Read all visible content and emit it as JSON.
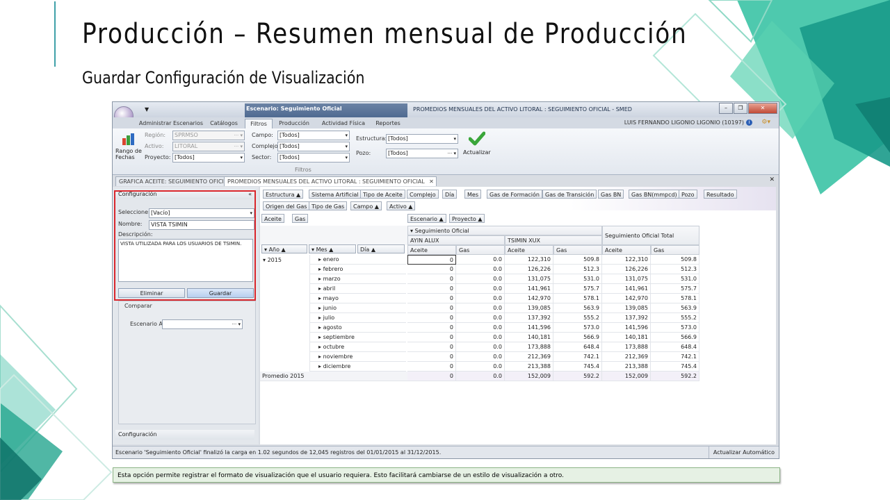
{
  "slide": {
    "title": "Producción – Resumen mensual de Producción",
    "subtitle": "Guardar Configuración de Visualización",
    "caption": "Esta opción permite registrar el formato de visualización que el usuario requiera. Esto facilitará cambiarse de un estilo de visualización a otro."
  },
  "app": {
    "context_tab": "Escenario: Seguimiento Oficial",
    "window_title": "PROMEDIOS MENSUALES  DEL ACTIVO LITORAL : SEGUIMIENTO OFICIAL - SMED",
    "user": "LUIS FERNANDO LIGONIO LIGONIO (10197)",
    "ribbon_tabs": [
      "Administrar Escenarios",
      "Catálogos",
      "Filtros",
      "Producción",
      "Actividad Física",
      "Reportes"
    ],
    "rango_label": "Rango de Fechas",
    "filters": {
      "region_label": "Región:",
      "region_value": "SPRMSO",
      "activo_label": "Activo:",
      "activo_value": "LITORAL",
      "proyecto_label": "Proyecto:",
      "proyecto_value": "[Todos]",
      "campo_label": "Campo:",
      "campo_value": "[Todos]",
      "complejo_label": "Complejo:",
      "complejo_value": "[Todos]",
      "sector_label": "Sector:",
      "sector_value": "[Todos]",
      "estructura_label": "Estructura:",
      "estructura_value": "[Todos]",
      "pozo_label": "Pozo:",
      "pozo_value": "[Todos]",
      "group_label": "Filtros",
      "actualizar_label": "Actualizar"
    },
    "doc_tabs": [
      "GRAFICA ACEITE: SEGUIMIENTO OFICIAL",
      "PROMEDIOS MENSUALES  DEL ACTIVO LITORAL : SEGUIMIENTO OFICIAL"
    ],
    "config": {
      "header": "Configuración",
      "seleccione_label": "Seleccione:",
      "seleccione_value": "[Vacío]",
      "nombre_label": "Nombre:",
      "nombre_value": "VISTA TSIMIN",
      "descripcion_label": "Descripción:",
      "descripcion_value": "VISTA UTILIZADA PARA LOS USUARIOS DE TSIMIN.",
      "eliminar": "Eliminar",
      "guardar": "Guardar",
      "comparar": "Comparar",
      "escenario_a_label": "Escenario A:",
      "footer": "Configuración"
    },
    "field_buttons_row1": [
      "Estructura ▲",
      "Sistema Artificial",
      "Tipo de Aceite",
      "Complejo",
      "Día",
      "Mes",
      "Gas de Formación",
      "Gas de Transición",
      "Gas BN",
      "Gas BN(mmpcd)",
      "Pozo",
      "Resultado"
    ],
    "field_buttons_row2": [
      "Origen del Gas",
      "Tipo de Gas",
      "Campo ▲",
      "Activo ▲"
    ],
    "data_fields": [
      "Aceite",
      "Gas"
    ],
    "column_fields": [
      "Escenario ▲",
      "Proyecto ▲"
    ],
    "row_fields": [
      "Año",
      "Mes",
      "Día"
    ],
    "col_headers": {
      "scenario": "Seguimiento Oficial",
      "proj1": "AYIN ALUX",
      "proj2": "TSIMIN XUX",
      "total": "Seguimiento Oficial Total",
      "aceite": "Aceite",
      "gas": "Gas"
    },
    "year": "2015",
    "rows": [
      {
        "mes": "enero",
        "v": [
          "0",
          "0.0",
          "122,310",
          "509.8",
          "122,310",
          "509.8"
        ]
      },
      {
        "mes": "febrero",
        "v": [
          "0",
          "0.0",
          "126,226",
          "512.3",
          "126,226",
          "512.3"
        ]
      },
      {
        "mes": "marzo",
        "v": [
          "0",
          "0.0",
          "131,075",
          "531.0",
          "131,075",
          "531.0"
        ]
      },
      {
        "mes": "abril",
        "v": [
          "0",
          "0.0",
          "141,961",
          "575.7",
          "141,961",
          "575.7"
        ]
      },
      {
        "mes": "mayo",
        "v": [
          "0",
          "0.0",
          "142,970",
          "578.1",
          "142,970",
          "578.1"
        ]
      },
      {
        "mes": "junio",
        "v": [
          "0",
          "0.0",
          "139,085",
          "563.9",
          "139,085",
          "563.9"
        ]
      },
      {
        "mes": "julio",
        "v": [
          "0",
          "0.0",
          "137,392",
          "555.2",
          "137,392",
          "555.2"
        ]
      },
      {
        "mes": "agosto",
        "v": [
          "0",
          "0.0",
          "141,596",
          "573.0",
          "141,596",
          "573.0"
        ]
      },
      {
        "mes": "septiembre",
        "v": [
          "0",
          "0.0",
          "140,181",
          "566.9",
          "140,181",
          "566.9"
        ]
      },
      {
        "mes": "octubre",
        "v": [
          "0",
          "0.0",
          "173,888",
          "648.4",
          "173,888",
          "648.4"
        ]
      },
      {
        "mes": "noviembre",
        "v": [
          "0",
          "0.0",
          "212,369",
          "742.1",
          "212,369",
          "742.1"
        ]
      },
      {
        "mes": "diciembre",
        "v": [
          "0",
          "0.0",
          "213,388",
          "745.4",
          "213,388",
          "745.4"
        ]
      }
    ],
    "promedio": {
      "label": "Promedio 2015",
      "v": [
        "0",
        "0.0",
        "152,009",
        "592.2",
        "152,009",
        "592.2"
      ]
    },
    "status": "Escenario 'Seguimiento Oficial' finalizó la carga en 1.02 segundos de 12,045 registros del 01/01/2015 al 31/12/2015.",
    "status_right": "Actualizar Automático"
  }
}
